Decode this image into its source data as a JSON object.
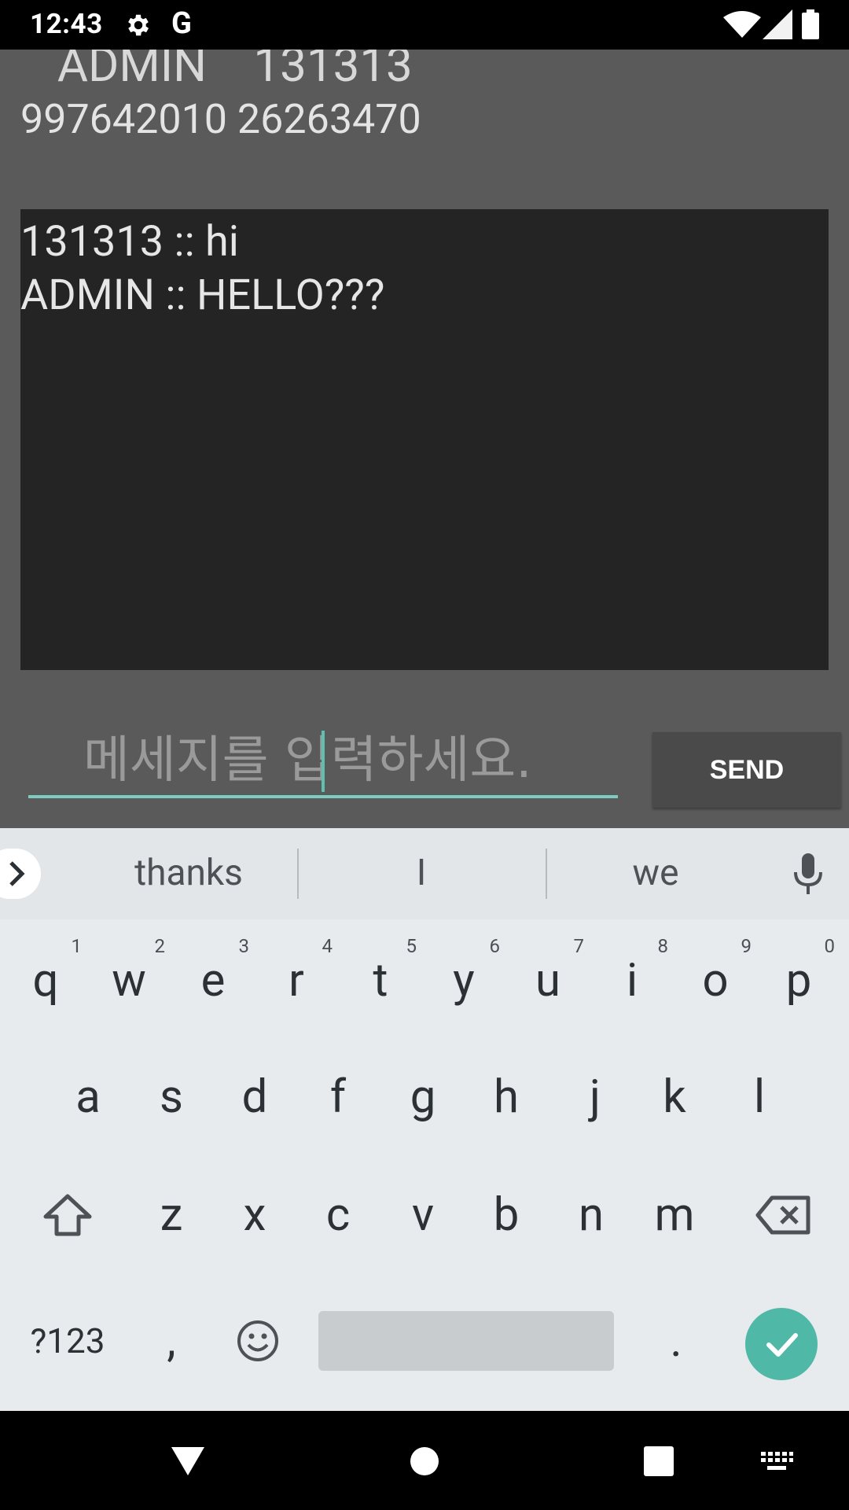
{
  "status_bar": {
    "time": "12:43",
    "google_glyph": "G",
    "icons": [
      "gear-icon",
      "wifi-icon",
      "signal-icon",
      "battery-icon"
    ]
  },
  "chat": {
    "user_line": " ADMIN    131313",
    "id_line": "997642010 26263470",
    "messages": [
      "131313 :: hi",
      "ADMIN :: HELLO???"
    ]
  },
  "composer": {
    "placeholder": "메세지를 입력하세요.",
    "value": "",
    "send_label": "SEND"
  },
  "keyboard": {
    "suggestions": [
      "thanks",
      "I",
      "we"
    ],
    "row1": [
      {
        "k": "q",
        "n": "1"
      },
      {
        "k": "w",
        "n": "2"
      },
      {
        "k": "e",
        "n": "3"
      },
      {
        "k": "r",
        "n": "4"
      },
      {
        "k": "t",
        "n": "5"
      },
      {
        "k": "y",
        "n": "6"
      },
      {
        "k": "u",
        "n": "7"
      },
      {
        "k": "i",
        "n": "8"
      },
      {
        "k": "o",
        "n": "9"
      },
      {
        "k": "p",
        "n": "0"
      }
    ],
    "row2": [
      "a",
      "s",
      "d",
      "f",
      "g",
      "h",
      "j",
      "k",
      "l"
    ],
    "row3": [
      "z",
      "x",
      "c",
      "v",
      "b",
      "n",
      "m"
    ],
    "symbols_label": "?123",
    "comma": ",",
    "period": "."
  },
  "colors": {
    "accent": "#4fb8a6",
    "app_bg": "#5a5a5a",
    "chat_bg": "#242424"
  }
}
